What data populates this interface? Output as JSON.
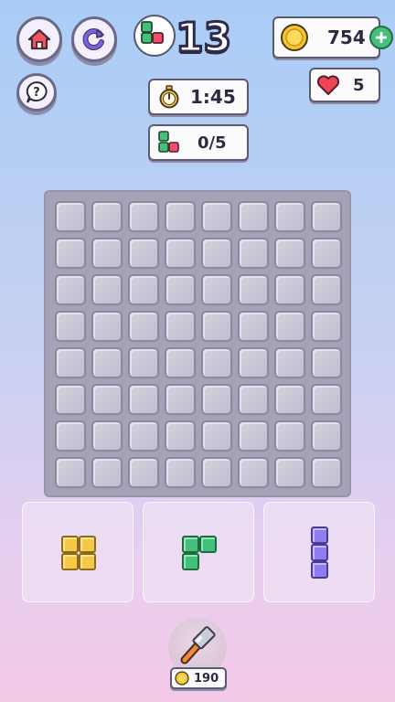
{
  "header": {
    "level": "13",
    "timer": "1:45",
    "goal": "0/5",
    "coins": "754",
    "lives": "5"
  },
  "booster": {
    "price": "190"
  },
  "board": {
    "rows": 8,
    "cols": 8
  },
  "colors": {
    "yellow_piece": "#f6c84a",
    "green_piece": "#45c07a",
    "purple_piece": "#8f7cf0",
    "home_icon": "#f0575e",
    "restart_icon": "#7b63e6",
    "heart": "#ee4458",
    "coin": "#f5c530"
  },
  "icons": [
    "home-icon",
    "restart-icon",
    "help-icon",
    "blocks-icon",
    "stopwatch-icon",
    "coin-icon",
    "plus-icon",
    "heart-icon",
    "hammer-icon"
  ],
  "pieces": [
    "square-2x2-yellow",
    "l-tromino-green",
    "vertical-3-purple"
  ]
}
